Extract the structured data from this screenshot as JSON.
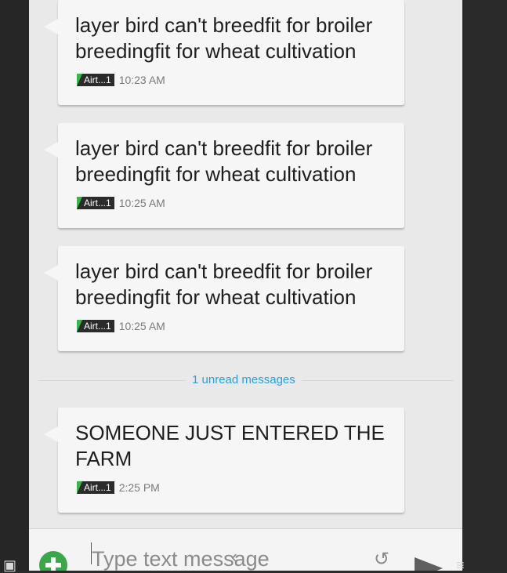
{
  "messages": [
    {
      "text": "layer bird can't breedfit for broiler breedingfit for wheat cultivation",
      "sim": "Airt...1",
      "time": "10:23 AM"
    },
    {
      "text": "layer bird can't breedfit for broiler breedingfit for wheat cultivation",
      "sim": "Airt...1",
      "time": "10:25 AM"
    },
    {
      "text": "layer bird can't breedfit for broiler breedingfit for wheat cultivation",
      "sim": "Airt...1",
      "time": "10:25 AM"
    },
    {
      "text": "SOMEONE JUST ENTERED THE FARM",
      "sim": "Airt...1",
      "time": "2:25 PM"
    }
  ],
  "divider": {
    "label": "1 unread messages"
  },
  "composer": {
    "placeholder": "Type text message",
    "value": ""
  },
  "icons": {
    "add": "add-circle-icon",
    "send": "send-icon",
    "screenshot": "screenshot-icon",
    "back": "back-icon",
    "recents": "recents-icon",
    "menu": "menu-icon"
  },
  "colors": {
    "background": "#e9e9e9",
    "bubble": "#f6f6f6",
    "unread_accent": "#2a9fd6",
    "sim_badge": "#3bb54a",
    "add_button": "#3aa84a"
  }
}
